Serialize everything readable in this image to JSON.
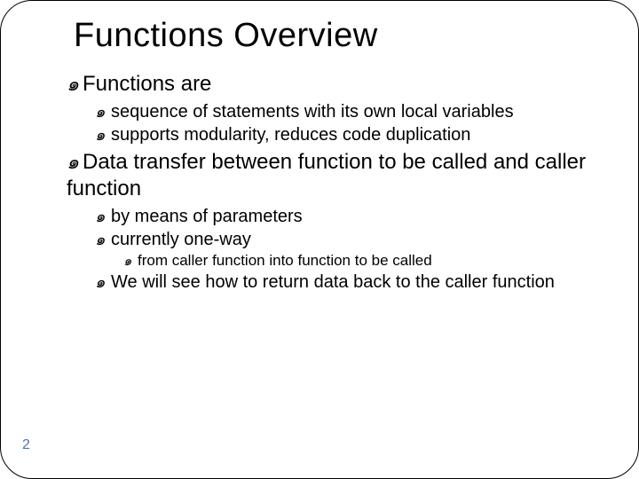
{
  "title": "Functions Overview",
  "bullet_glyph": "๑",
  "page_number": "2",
  "items": {
    "l1a": "Functions are",
    "l2a": "sequence of statements with its own local variables",
    "l2b": "supports modularity, reduces code duplication",
    "l1b": "Data transfer between function to be called and caller function",
    "l2c": "by means of parameters",
    "l2d": "currently one-way",
    "l3a": "from caller function into function to be called",
    "l2e": "We will see how to return data back to the caller function"
  }
}
